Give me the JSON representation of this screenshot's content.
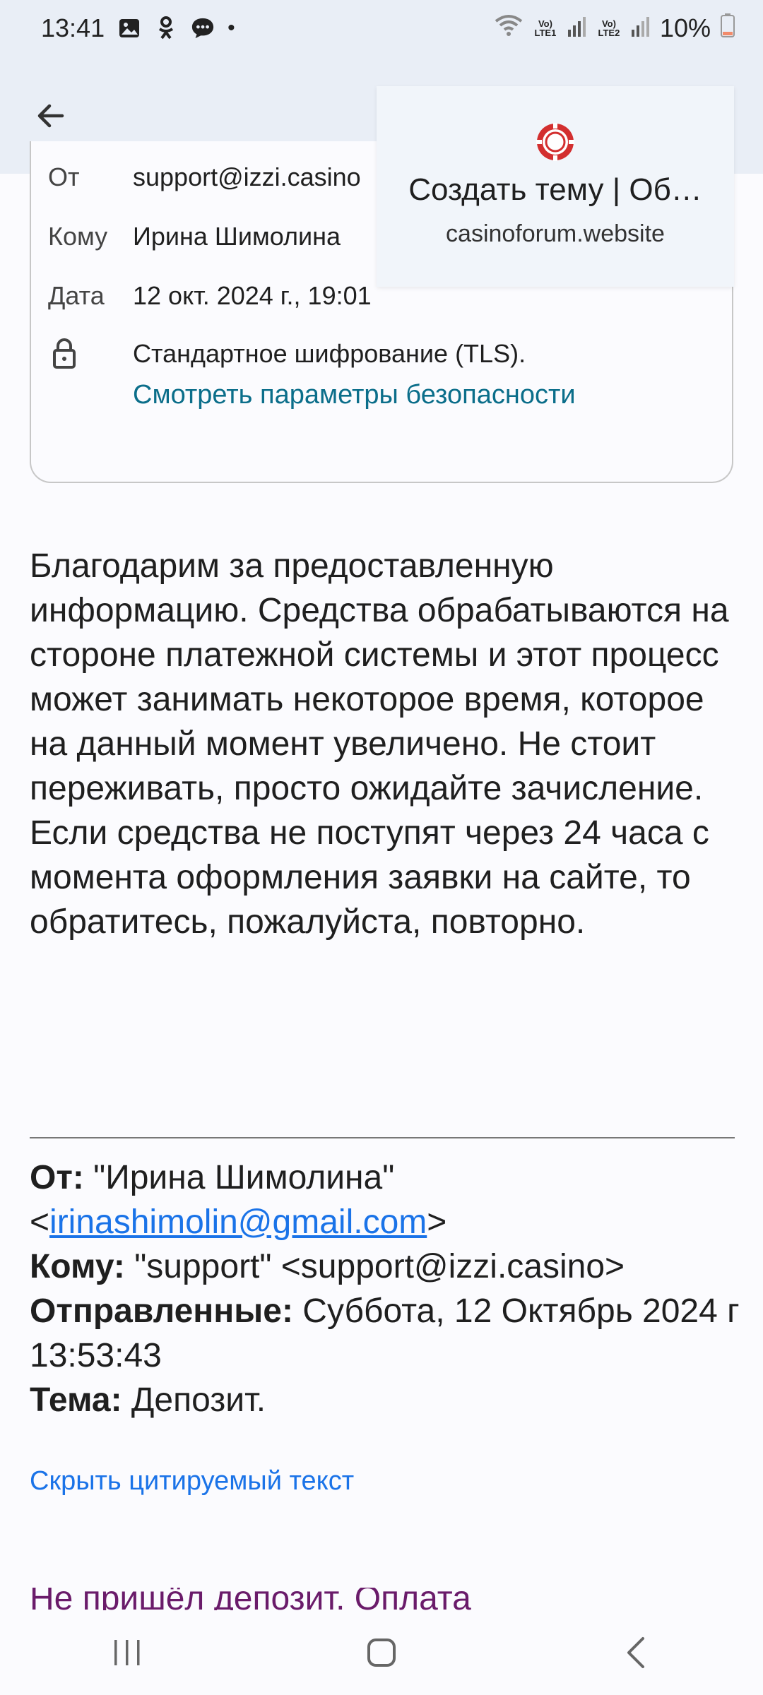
{
  "status": {
    "time": "13:41",
    "battery": "10%",
    "sim1": "Vo) LTE1",
    "sim2": "Vo) LTE2",
    "icons": [
      "gallery-icon",
      "odnoklassniki-icon",
      "message-icon",
      "dot-icon",
      "wifi-icon",
      "signal-icon",
      "battery-icon"
    ]
  },
  "details": {
    "from_label": "От",
    "from_value": "support@izzi.casino",
    "to_label": "Кому",
    "to_value": "Ирина Шимолина",
    "date_label": "Дата",
    "date_value": "12 окт. 2024 г., 19:01",
    "encryption": "Стандартное шифрование (TLS).",
    "security_link": "Смотреть параметры безопасности"
  },
  "popup": {
    "title": "Создать тему | Об…",
    "site": "casinoforum.website"
  },
  "message": {
    "body": "Благодарим за предоставленную информацию. Средства обрабатываются на стороне платежной системы и этот процесс может занимать некоторое время, которое на данный момент увеличено. Не стоит переживать, просто ожидайте зачисление. Если средства не поступят через 24 часа с момента оформления заявки на сайте, то обратитесь, пожалуйста, повторно."
  },
  "quoted": {
    "from_label": "От:",
    "from_name": "\"Ирина Шимолина\"",
    "from_email": "irinashimolin@gmail.com",
    "to_label": "Кому:",
    "to_value": "\"support\" <support@izzi.casino>",
    "sent_label": "Отправленные:",
    "sent_value": "Суббота, 12 Октябрь 2024 г 13:53:43",
    "subject_label": "Тема:",
    "subject_value": "Депозит.",
    "hide_link": "Скрыть цитируемый текст",
    "cut_text": "Не пришёл депозит. Оплата"
  },
  "colors": {
    "header_bg": "#e9eef6",
    "link_teal": "#0b6e8a",
    "link_blue": "#1a73e8",
    "visited_link": "#6a1b6a"
  }
}
